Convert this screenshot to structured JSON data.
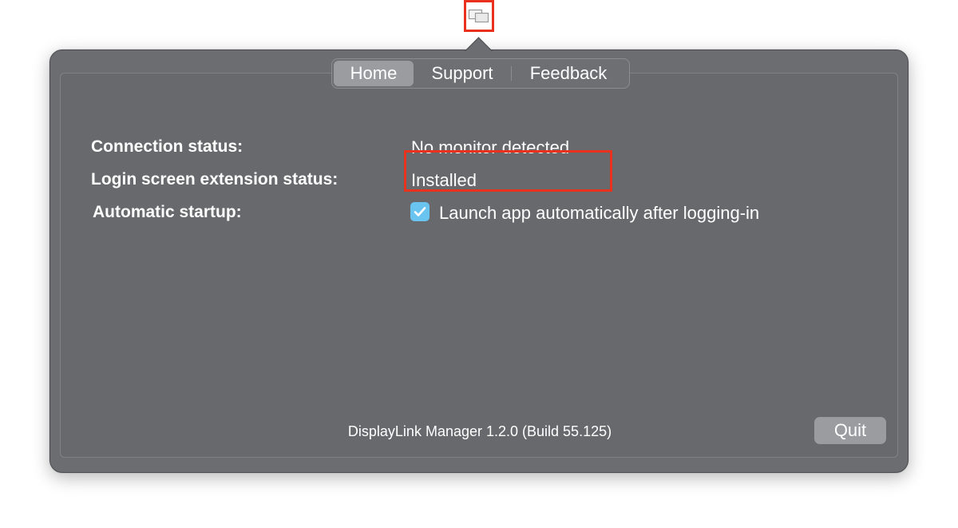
{
  "menubar": {
    "icon": "displaylink-displays-icon"
  },
  "tabs": [
    {
      "label": "Home",
      "active": true
    },
    {
      "label": "Support",
      "active": false
    },
    {
      "label": "Feedback",
      "active": false
    }
  ],
  "home": {
    "connection_label": "Connection status:",
    "connection_value": "No monitor detected",
    "login_ext_label": "Login screen extension status:",
    "login_ext_value": "Installed",
    "startup_label": "Automatic startup:",
    "startup_checkbox_label": "Launch app automatically after logging-in",
    "startup_checked": true
  },
  "footer": {
    "version": "DisplayLink Manager 1.2.0 (Build 55.125)",
    "quit_label": "Quit"
  },
  "colors": {
    "panel": "#6b6d70",
    "highlight": "#e8321e",
    "checkbox": "#6ac4f0"
  }
}
